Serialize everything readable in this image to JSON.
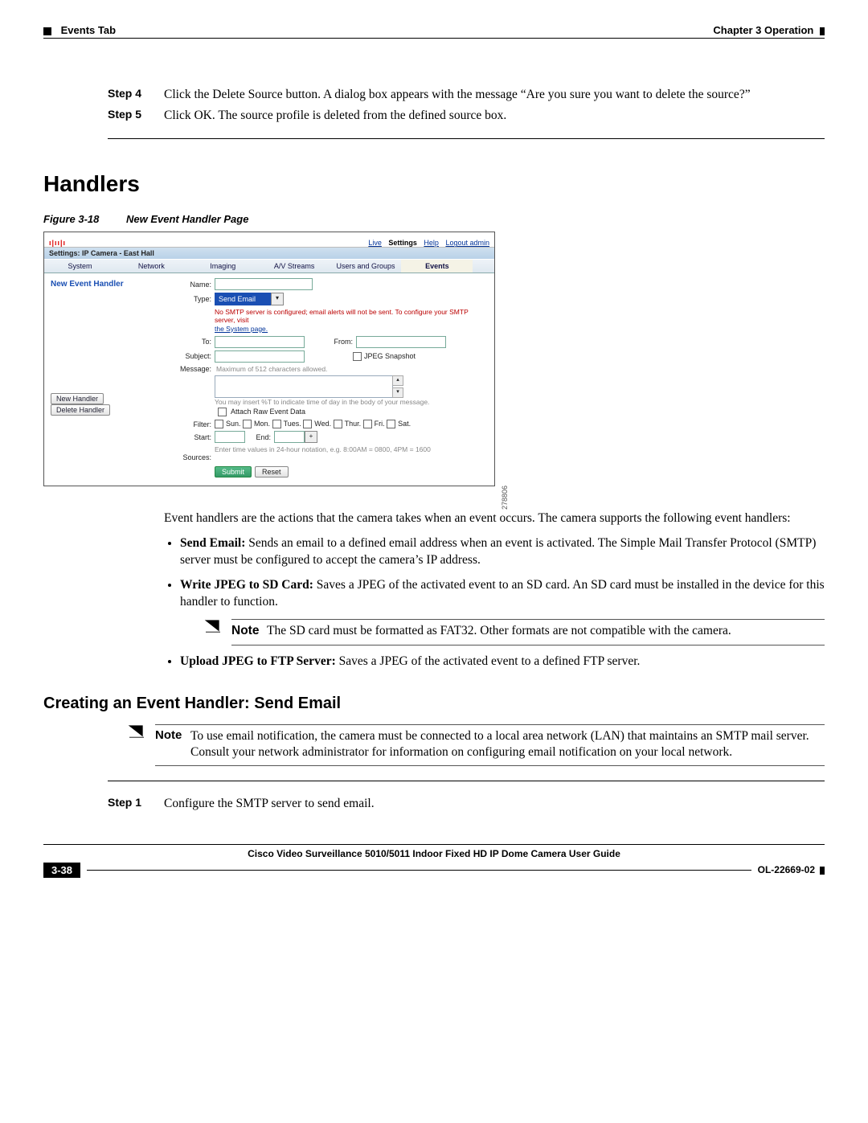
{
  "header": {
    "left": "Events Tab",
    "right": "Chapter 3      Operation"
  },
  "steps_top": [
    {
      "label": "Step 4",
      "text": "Click the Delete Source button. A dialog box appears with the message “Are you sure you want to delete the source?”"
    },
    {
      "label": "Step 5",
      "text": "Click OK. The source profile is deleted from the defined source box."
    }
  ],
  "section": {
    "title": "Handlers"
  },
  "figure": {
    "label": "Figure 3-18",
    "title": "New Event Handler Page",
    "id": "278806"
  },
  "screenshot": {
    "logo": "cisco",
    "links": {
      "live": "Live",
      "settings": "Settings",
      "help": "Help",
      "logout": "Logout admin"
    },
    "settings_line": "Settings: IP Camera - East Hall",
    "tabs": [
      "System",
      "Network",
      "Imaging",
      "A/V Streams",
      "Users and Groups",
      "Events"
    ],
    "active_tab": "Events",
    "page_title": "New Event Handler",
    "sidebar_buttons": {
      "new": "New Handler",
      "delete": "Delete Handler"
    },
    "labels": {
      "name": "Name:",
      "type": "Type:",
      "to": "To:",
      "from": "From:",
      "subject": "Subject:",
      "jpeg_snapshot": "JPEG Snapshot",
      "message": "Message:",
      "attach_raw": "Attach Raw Event Data",
      "filter": "Filter:",
      "start": "Start:",
      "end": "End:",
      "sources": "Sources:"
    },
    "type_value": "Send Email",
    "warning_line1": "No SMTP server is configured; email alerts will not be sent. To configure your SMTP server, visit",
    "warning_link": "the System page.",
    "message_help": "Maximum of 512 characters allowed.",
    "message_hint": "You may insert %T to indicate time of day in the body of your message.",
    "days": [
      "Sun.",
      "Mon.",
      "Tues.",
      "Wed.",
      "Thur.",
      "Fri.",
      "Sat."
    ],
    "time_hint": "Enter time values in 24-hour notation, e.g. 8:00AM = 0800, 4PM = 1600",
    "buttons": {
      "submit": "Submit",
      "reset": "Reset"
    }
  },
  "body": {
    "intro": "Event handlers are the actions that the camera takes when an event occurs. The camera supports the following event handlers:",
    "bullets": [
      {
        "lead": "Send Email:",
        "text": " Sends an email to a defined email address when an event is activated. The Simple Mail Transfer Protocol (SMTP) server must be configured to accept the camera’s IP address."
      },
      {
        "lead": "Write JPEG to SD Card:",
        "text": " Saves a JPEG of the activated event to an SD card. An SD card must be installed in the device for this handler to function.",
        "note": {
          "label": "Note",
          "text": "The SD card must be formatted as FAT32. Other formats are not compatible with the camera."
        }
      },
      {
        "lead": "Upload JPEG to FTP Server:",
        "text": " Saves a JPEG of the activated event to a defined FTP server."
      }
    ]
  },
  "subsection": {
    "title": "Creating an Event Handler: Send Email",
    "note": {
      "label": "Note",
      "text": "To use email notification, the camera must be connected to a local area network (LAN) that maintains an SMTP mail server. Consult your network administrator for information on configuring email notification on your local network."
    },
    "steps": [
      {
        "label": "Step 1",
        "text": "Configure the SMTP server to send email."
      }
    ]
  },
  "footer": {
    "title": "Cisco Video Surveillance 5010/5011 Indoor Fixed HD IP Dome Camera User Guide",
    "page": "3-38",
    "docid": "OL-22669-02"
  }
}
